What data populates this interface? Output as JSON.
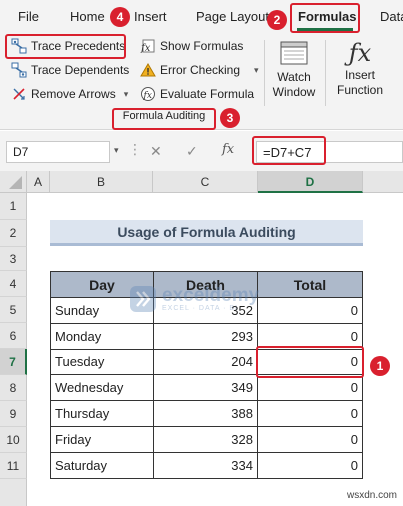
{
  "ribbon_tabs": [
    {
      "label": "File"
    },
    {
      "label": "Home"
    },
    {
      "label": "Insert"
    },
    {
      "label": "Page Layout"
    },
    {
      "label": "Formulas"
    },
    {
      "label": "Data"
    }
  ],
  "active_tab": "Formulas",
  "formula_auditing": {
    "trace_precedents": "Trace Precedents",
    "trace_dependents": "Trace Dependents",
    "remove_arrows": "Remove Arrows",
    "show_formulas": "Show Formulas",
    "error_checking": "Error Checking",
    "evaluate_formula": "Evaluate Formula",
    "watch_window_line1": "Watch",
    "watch_window_line2": "Window",
    "group_label": "Formula Auditing"
  },
  "insert_function": {
    "line1": "Insert",
    "line2": "Function"
  },
  "badges": {
    "one": "1",
    "two": "2",
    "three": "3",
    "four": "4"
  },
  "formula_bar": {
    "name_box": "D7",
    "cancel_glyph": "✕",
    "enter_glyph": "✓",
    "fx_glyph": "fx",
    "formula": "=D7+C7"
  },
  "columns": [
    "A",
    "B",
    "C",
    "D"
  ],
  "rows": [
    "1",
    "2",
    "3",
    "4",
    "5",
    "6",
    "7",
    "8",
    "9",
    "10",
    "11"
  ],
  "sheet": {
    "title": "Usage of Formula Auditing",
    "headers": {
      "day": "Day",
      "death": "Death",
      "total": "Total"
    },
    "records": [
      {
        "day": "Sunday",
        "death": "352",
        "total": "0"
      },
      {
        "day": "Monday",
        "death": "293",
        "total": "0"
      },
      {
        "day": "Tuesday",
        "death": "204",
        "total": "0"
      },
      {
        "day": "Wednesday",
        "death": "349",
        "total": "0"
      },
      {
        "day": "Thursday",
        "death": "388",
        "total": "0"
      },
      {
        "day": "Friday",
        "death": "328",
        "total": "0"
      },
      {
        "day": "Saturday",
        "death": "334",
        "total": "0"
      }
    ]
  },
  "watermark": {
    "name": "exceldemy",
    "tagline": "EXCEL · DATA · BI"
  },
  "site": "wsxdn.com",
  "colors": {
    "accent_green": "#1f7145",
    "highlight_red": "#d9202e",
    "header_fill": "#adb9ca",
    "title_fill": "#dce4ef"
  }
}
